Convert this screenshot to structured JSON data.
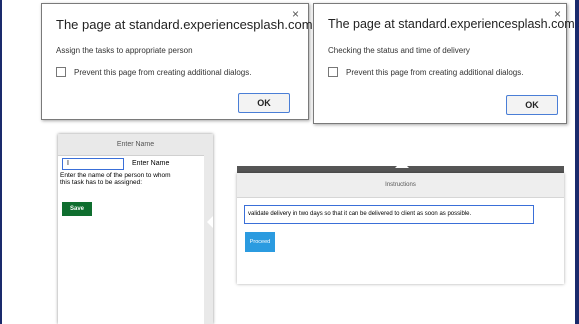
{
  "alert_left": {
    "title": "The page at standard.experiencesplash.com says:",
    "close_glyph": "×",
    "message": "Assign the tasks to appropriate person",
    "prevent_label": "Prevent this page from creating additional dialogs.",
    "ok_label": "OK"
  },
  "alert_right": {
    "title": "The page at standard.experiencesplash.com says:",
    "close_glyph": "×",
    "message": "Checking the status and time of delivery",
    "prevent_label": "Prevent this page from creating additional dialogs.",
    "ok_label": "OK"
  },
  "name_panel": {
    "header": "Enter Name",
    "input_value": "I",
    "input_label": "Enter Name",
    "help_text": "Enter the name of the person to whom this task has to be assigned:",
    "save_label": "Save"
  },
  "instructions_panel": {
    "header": "Instructions",
    "input_value": "validate delivery in two days so that it can be delivered to client as soon as possible.",
    "proceed_label": "Proceed"
  },
  "colors": {
    "frame": "#1a2a6c",
    "save_button": "#0f6e2f",
    "proceed_button": "#2b9be0",
    "focus_border": "#3a6fd8"
  }
}
